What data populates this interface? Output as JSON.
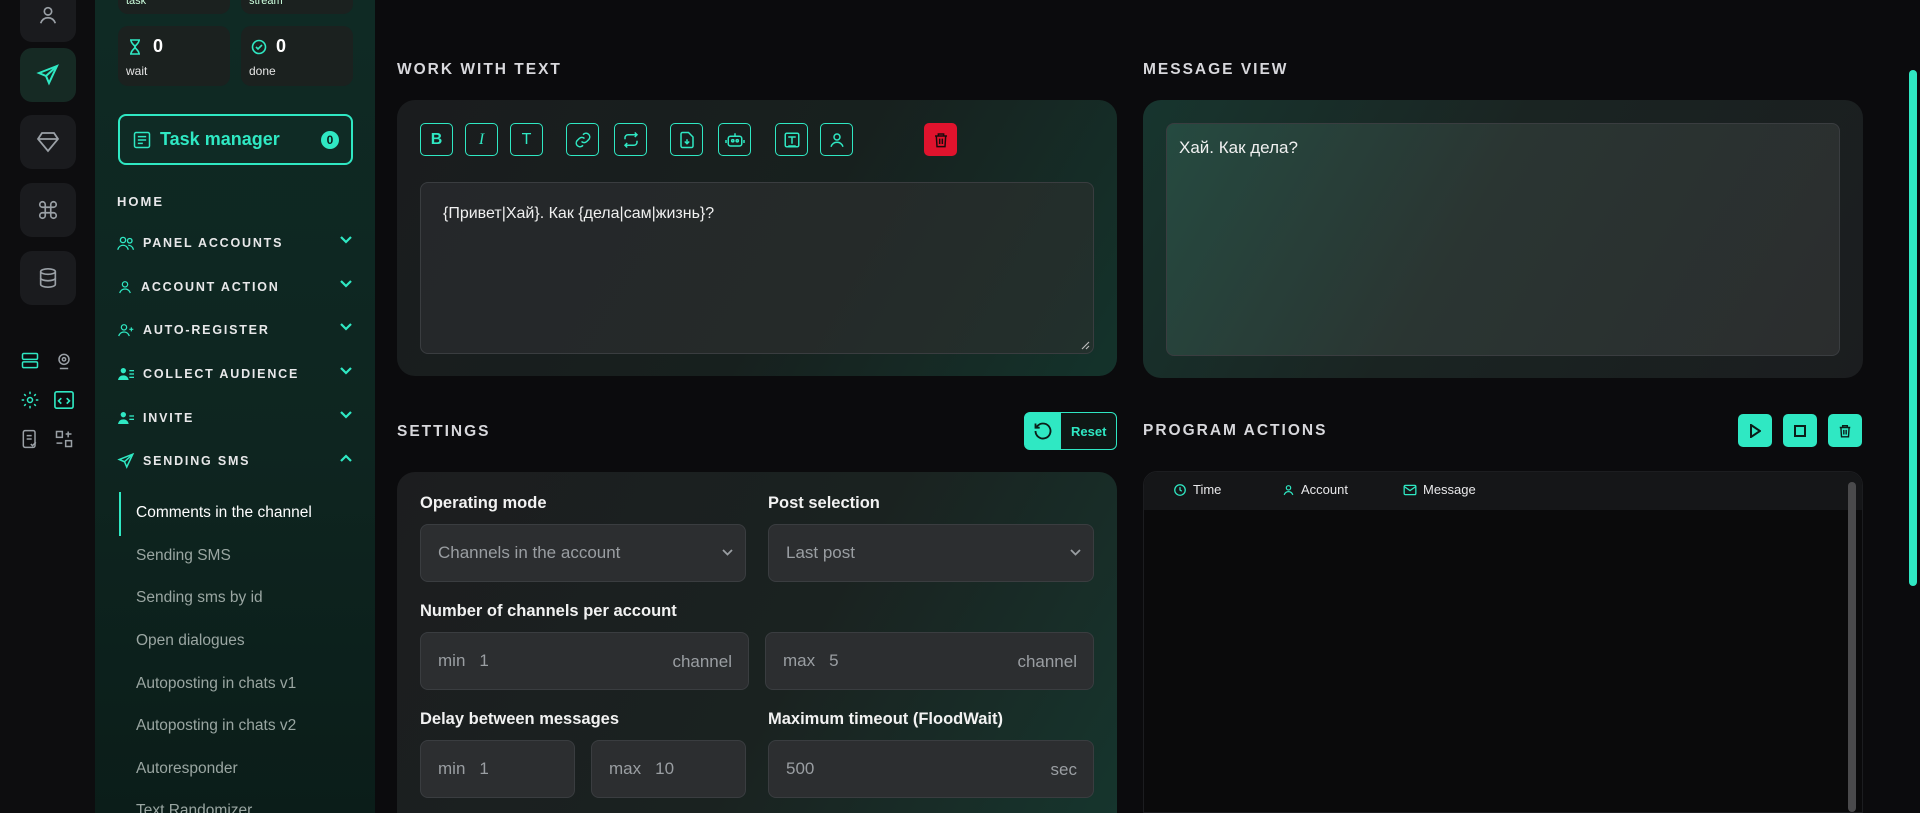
{
  "stats": {
    "top_left_label": "task",
    "top_right_label": "stream",
    "wait": {
      "value": "0",
      "label": "wait"
    },
    "done": {
      "value": "0",
      "label": "done"
    }
  },
  "task_manager": {
    "label": "Task manager",
    "count": "0"
  },
  "nav": {
    "home": "HOME",
    "sections": [
      {
        "label": "PANEL ACCOUNTS",
        "icon": "users-icon"
      },
      {
        "label": "ACCOUNT ACTION",
        "icon": "user-icon"
      },
      {
        "label": "AUTO-REGISTER",
        "icon": "user-plus-icon"
      },
      {
        "label": "COLLECT AUDIENCE",
        "icon": "users-list-icon"
      },
      {
        "label": "INVITE",
        "icon": "user-invite-icon"
      },
      {
        "label": "SENDING SMS",
        "icon": "send-icon"
      }
    ],
    "sub_items": [
      "Comments in the channel",
      "Sending SMS",
      "Sending sms by id",
      "Open dialogues",
      "Autoposting in chats v1",
      "Autoposting in chats v2",
      "Autoresponder",
      "Text Randomizer"
    ]
  },
  "work_with_text": {
    "title": "WORK WITH TEXT",
    "text": "{Привет|Хай}. Как {дела|сам|жизнь}?",
    "tools": [
      "B",
      "I",
      "T"
    ]
  },
  "message_view": {
    "title": "MESSAGE VIEW",
    "text": "Хай. Как дела?"
  },
  "settings": {
    "title": "SETTINGS",
    "reset_label": "Reset",
    "operating_mode": {
      "label": "Operating mode",
      "value": "Channels in the account"
    },
    "post_selection": {
      "label": "Post selection",
      "value": "Last post"
    },
    "channels_per_account": {
      "label": "Number of channels per account",
      "min_label": "min",
      "min_value": "1",
      "min_unit": "channel",
      "max_label": "max",
      "max_value": "5",
      "max_unit": "channel"
    },
    "delay": {
      "label": "Delay between messages",
      "min_label": "min",
      "min_value": "1",
      "max_label": "max",
      "max_value": "10"
    },
    "timeout": {
      "label": "Maximum timeout (FloodWait)",
      "value": "500",
      "unit": "sec"
    }
  },
  "program_actions": {
    "title": "PROGRAM ACTIONS",
    "columns": [
      "Time",
      "Account",
      "Message"
    ]
  },
  "colors": {
    "accent": "#2fe8c3",
    "danger": "#e0132d",
    "background": "#0b0b0d"
  }
}
